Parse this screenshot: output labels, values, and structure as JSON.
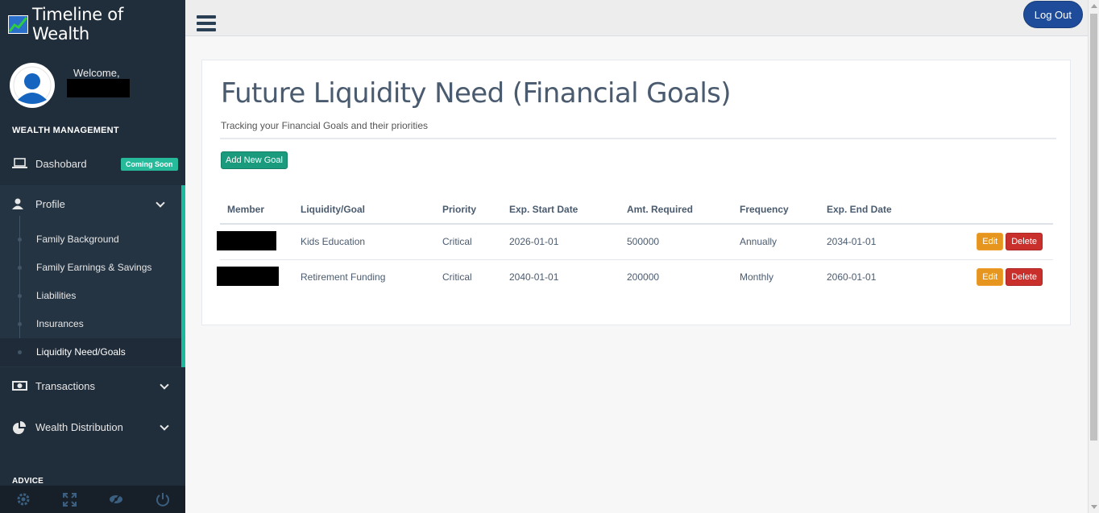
{
  "app": {
    "brand": "Timeline of Wealth"
  },
  "profile": {
    "welcome": "Welcome,"
  },
  "sidebar": {
    "section_wealth": "WEALTH MANAGEMENT",
    "section_advice": "ADVICE",
    "items": [
      {
        "label": "Dashobard",
        "icon": "laptop-icon",
        "badge": "Coming Soon"
      },
      {
        "label": "Profile",
        "icon": "user-icon"
      },
      {
        "label": "Transactions",
        "icon": "money-icon"
      },
      {
        "label": "Wealth Distribution",
        "icon": "pie-chart-icon"
      }
    ],
    "profile_sub": [
      {
        "label": "Family Background"
      },
      {
        "label": "Family Earnings & Savings"
      },
      {
        "label": "Liabilities"
      },
      {
        "label": "Insurances"
      },
      {
        "label": "Liquidity Need/Goals"
      }
    ],
    "footer": [
      "gear-icon",
      "fullscreen-icon",
      "eye-slash-icon",
      "power-icon"
    ]
  },
  "topbar": {
    "logout": "Log Out"
  },
  "main": {
    "title": "Future Liquidity Need (Financial Goals)",
    "subtitle": "Tracking your Financial Goals and their priorities",
    "add_button": "Add New Goal",
    "table": {
      "headers": [
        "Member",
        "Liquidity/Goal",
        "Priority",
        "Exp. Start Date",
        "Amt. Required",
        "Frequency",
        "Exp. End Date"
      ],
      "rows": [
        {
          "goal": "Kids Education",
          "priority": "Critical",
          "start": "2026-01-01",
          "amount": "500000",
          "frequency": "Annually",
          "end": "2034-01-01"
        },
        {
          "goal": "Retirement Funding",
          "priority": "Critical",
          "start": "2040-01-01",
          "amount": "200000",
          "frequency": "Monthly",
          "end": "2060-01-01"
        }
      ],
      "edit_label": "Edit",
      "delete_label": "Delete"
    }
  },
  "colors": {
    "sidebar": "#202d3a",
    "accent": "#1abb9c",
    "edit": "#e6951f",
    "delete": "#c9302c",
    "logout": "#1e4c9a"
  }
}
